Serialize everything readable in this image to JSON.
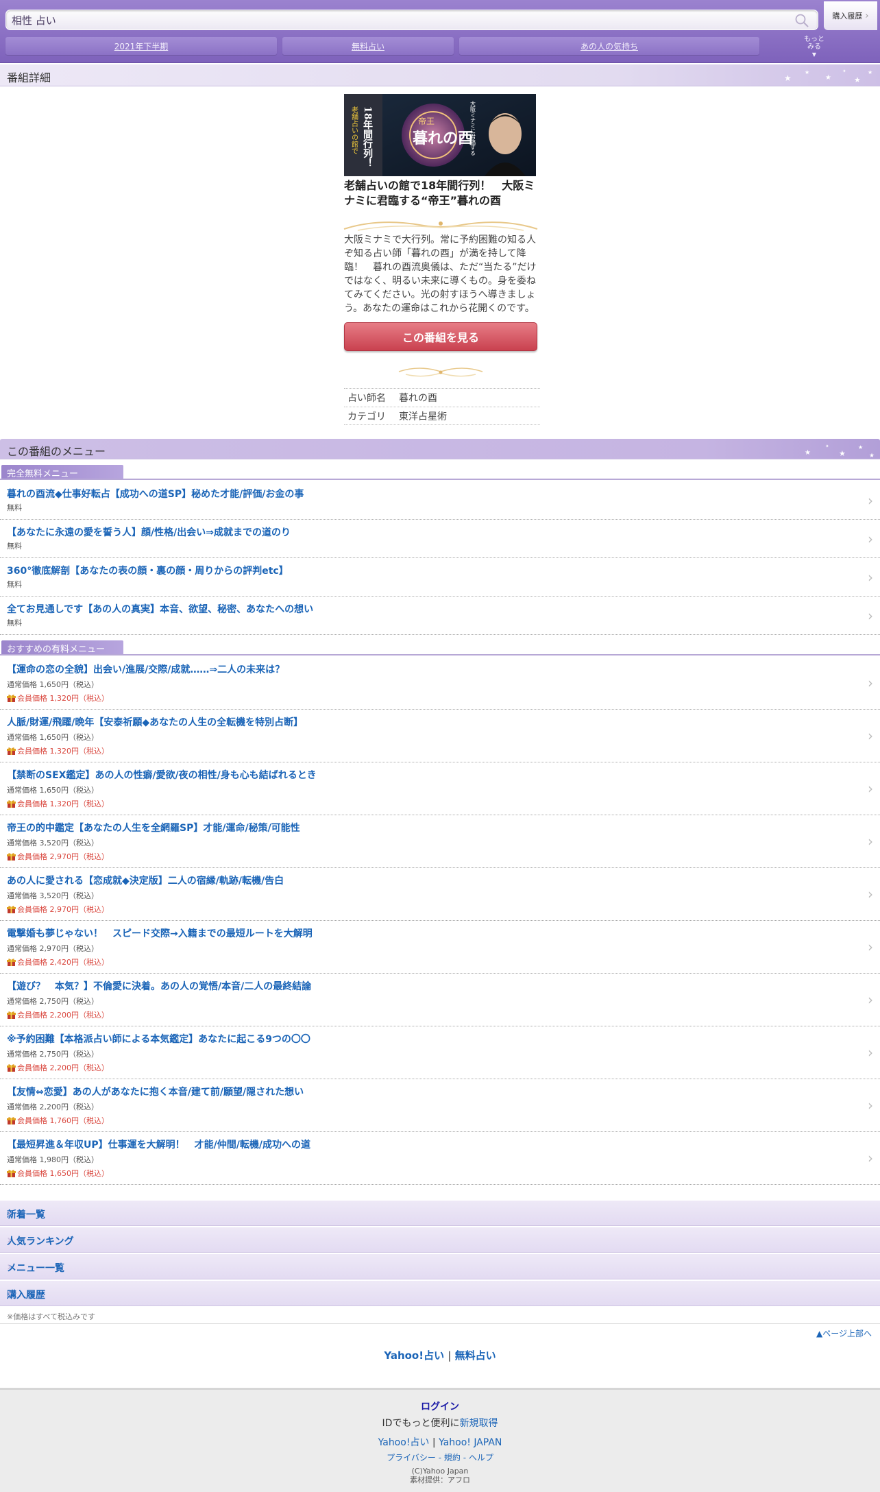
{
  "header": {
    "search_value": "相性 占い",
    "history_label": "購入履歴",
    "tabs": [
      "2021年下半期",
      "無料占い",
      "あの人の気持ち"
    ],
    "more_line1": "もっと",
    "more_line2": "みる"
  },
  "detail_title": "番組詳細",
  "program": {
    "banner_text_left": "老舗占いの館で",
    "banner_text_left2": "18年間行列！",
    "banner_title": "暮れの酉",
    "banner_sub": "帝王",
    "banner_right": "大阪ミナミに君臨する",
    "title": "老舗占いの館で18年間行列！　大阪ミナミに君臨する“帝王”暮れの酉",
    "description": "大阪ミナミで大行列。常に予約困難の知る人ぞ知る占い師「暮れの酉」が満を持して降臨！　暮れの酉流奥儀は、ただ“当たる”だけではなく、明るい未来に導くもの。身を委ねてみてください。光の射すほうへ導きましょう。あなたの運命はこれから花開くのです。",
    "watch_button": "この番組を見る",
    "info": [
      {
        "key": "占い師名",
        "value": "暮れの酉"
      },
      {
        "key": "カテゴリ",
        "value": "東洋占星術"
      }
    ]
  },
  "menu_section_title": "この番組のメニュー",
  "free_menu": {
    "label": "完全無料メニュー",
    "items": [
      {
        "title": "暮れの酉流◆仕事好転占【成功への道SP】秘めた才能/評価/お金の事",
        "price": "無料"
      },
      {
        "title": "【あなたに永遠の愛を誓う人】顔/性格/出会い⇒成就までの道のり",
        "price": "無料"
      },
      {
        "title": "360°徹底解剖【あなたの表の顔・裏の顔・周りからの評判etc】",
        "price": "無料"
      },
      {
        "title": "全てお見通しです【あの人の真実】本音、欲望、秘密、あなたへの想い",
        "price": "無料"
      }
    ]
  },
  "paid_menu": {
    "label": "おすすめの有料メニュー",
    "items": [
      {
        "title": "【運命の恋の全貌】出会い/進展/交際/成就……⇒二人の未来は？",
        "normal": "通常価格 1,650円（税込）",
        "member": "会員価格 1,320円（税込）"
      },
      {
        "title": "人脈/財運/飛躍/晩年【安泰祈願◆あなたの人生の全転機を特別占断】",
        "normal": "通常価格 1,650円（税込）",
        "member": "会員価格 1,320円（税込）"
      },
      {
        "title": "【禁断のSEX鑑定】あの人の性癖/愛欲/夜の相性/身も心も結ばれるとき",
        "normal": "通常価格 1,650円（税込）",
        "member": "会員価格 1,320円（税込）"
      },
      {
        "title": "帝王の的中鑑定【あなたの人生を全網羅SP】才能/運命/秘策/可能性",
        "normal": "通常価格 3,520円（税込）",
        "member": "会員価格 2,970円（税込）"
      },
      {
        "title": "あの人に愛される【恋成就◆決定版】二人の宿縁/軌跡/転機/告白",
        "normal": "通常価格 3,520円（税込）",
        "member": "会員価格 2,970円（税込）"
      },
      {
        "title": "電撃婚も夢じゃない！　スピード交際→入籍までの最短ルートを大解明",
        "normal": "通常価格 2,970円（税込）",
        "member": "会員価格 2,420円（税込）"
      },
      {
        "title": "【遊び？　本気？】不倫愛に決着。あの人の覚悟/本音/二人の最終結論",
        "normal": "通常価格 2,750円（税込）",
        "member": "会員価格 2,200円（税込）"
      },
      {
        "title": "※予約困難【本格派占い師による本気鑑定】あなたに起こる9つの〇〇",
        "normal": "通常価格 2,750円（税込）",
        "member": "会員価格 2,200円（税込）"
      },
      {
        "title": "【友情⇔恋愛】あの人があなたに抱く本音/建て前/願望/隠された想い",
        "normal": "通常価格 2,200円（税込）",
        "member": "会員価格 1,760円（税込）"
      },
      {
        "title": "【最短昇進＆年収UP】仕事運を大解明！　才能/仲間/転機/成功への道",
        "normal": "通常価格 1,980円（税込）",
        "member": "会員価格 1,650円（税込）"
      }
    ]
  },
  "nav_links": [
    "新着一覧",
    "人気ランキング",
    "メニュー一覧",
    "購入履歴"
  ],
  "tax_note": "※価格はすべて税込みです",
  "page_top": "▲ページ上部へ",
  "bottom_links": {
    "a": "Yahoo!占い",
    "sep": "|",
    "b": "無料占い"
  },
  "footer": {
    "login": "ログイン",
    "id_text": "IDでもっと便利に",
    "signup": "新規取得",
    "yahoo_uranai": "Yahoo!占い",
    "yahoo_japan": "Yahoo! JAPAN",
    "privacy": "プライバシー",
    "terms": "規約",
    "help": "ヘルプ",
    "copyright": "(C)Yahoo Japan",
    "material": "素材提供：アフロ"
  }
}
